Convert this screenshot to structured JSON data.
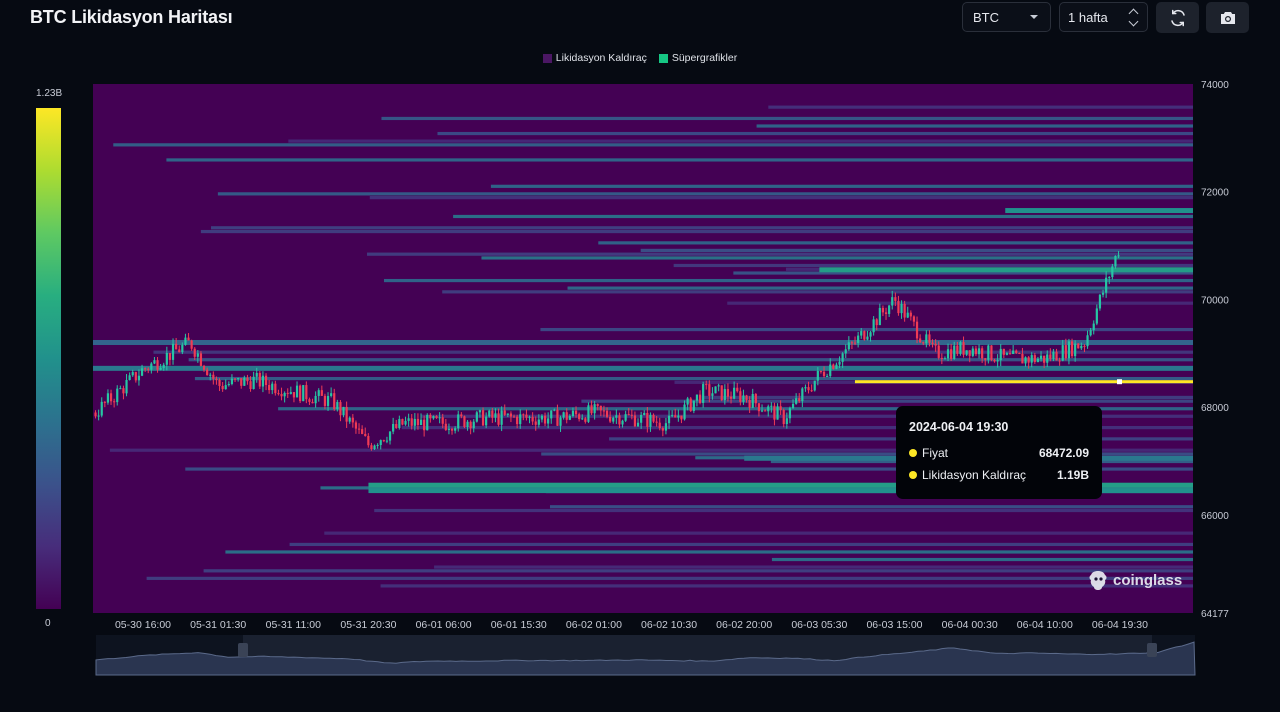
{
  "header": {
    "title": "BTC Likidasyon Haritası",
    "symbol_select": "BTC",
    "period_stepper": "1 hafta",
    "refresh_icon": "refresh-icon",
    "camera_icon": "camera-icon"
  },
  "colors": {
    "background": "#060a12",
    "heatmap_low": "#440154",
    "heatmap_high": "#fde725",
    "candle_up": "#26c6a4",
    "candle_down": "#ef3b55",
    "legend_liq": "#4b1764",
    "legend_super": "#16c784"
  },
  "colorbar": {
    "max_label": "1.23B",
    "min_label": "0"
  },
  "tooltip": {
    "title": "2024-06-04 19:30",
    "price_label": "Fiyat",
    "price_value": "68472.09",
    "lev_label": "Likidasyon Kaldıraç",
    "lev_value": "1.19B"
  },
  "watermark": "coinglass",
  "chart_data": {
    "type": "heatmap",
    "title": "BTC Likidasyon Haritası",
    "legend": [
      "Likidasyon Kaldıraç",
      "Süpergrafikler"
    ],
    "legend_placement": "top-center",
    "x_tick_labels": [
      "05-30 16:00",
      "05-31 01:30",
      "05-31 11:00",
      "05-31 20:30",
      "06-01 06:00",
      "06-01 15:30",
      "06-02 01:00",
      "06-02 10:30",
      "06-02 20:00",
      "06-03 05:30",
      "06-03 15:00",
      "06-04 00:30",
      "06-04 10:00",
      "06-04 19:30"
    ],
    "y_tick_labels": [
      "74000",
      "72000",
      "70000",
      "68000",
      "66000",
      "64177"
    ],
    "ylim": [
      64177,
      74000
    ],
    "colorbar_range": [
      "0",
      "1.23B"
    ],
    "price_series": {
      "name": "Fiyat",
      "x": [
        "05-30 10:00",
        "05-30 16:00",
        "05-30 22:00",
        "05-31 01:30",
        "05-31 06:00",
        "05-31 11:00",
        "05-31 16:00",
        "05-31 20:30",
        "06-01 01:00",
        "06-01 06:00",
        "06-01 11:00",
        "06-01 15:30",
        "06-01 20:00",
        "06-02 01:00",
        "06-02 06:00",
        "06-02 10:30",
        "06-02 15:00",
        "06-02 20:00",
        "06-03 01:00",
        "06-03 05:30",
        "06-03 10:00",
        "06-03 15:00",
        "06-03 20:00",
        "06-04 00:30",
        "06-04 05:00",
        "06-04 10:00",
        "06-04 15:00",
        "06-04 19:30"
      ],
      "y": [
        67900,
        68700,
        69200,
        68400,
        68500,
        68300,
        68100,
        67300,
        67700,
        67700,
        67800,
        67800,
        67800,
        67900,
        67800,
        67700,
        68300,
        68200,
        67800,
        68600,
        69200,
        70000,
        69000,
        69100,
        68900,
        68900,
        69200,
        71000
      ]
    },
    "highlighted_level": {
      "price": 68472.09,
      "leverage": "1.19B"
    }
  }
}
